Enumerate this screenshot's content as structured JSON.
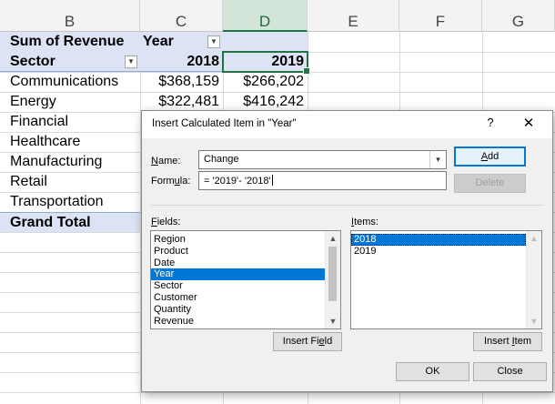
{
  "sheet": {
    "columns": [
      "B",
      "C",
      "D",
      "E",
      "F",
      "G"
    ],
    "pivot": {
      "corner_label": "Sum of Revenue",
      "col_field_label": "Year",
      "row_field_label": "Sector",
      "year_2018": "2018",
      "year_2019": "2019",
      "rows": [
        {
          "label": "Communications",
          "v2018": "$368,159",
          "v2019": "$266,202"
        },
        {
          "label": "Energy",
          "v2018": "$322,481",
          "v2019": "$416,242"
        },
        {
          "label": "Financial",
          "v2018": "",
          "v2019": ""
        },
        {
          "label": "Healthcare",
          "v2018": "",
          "v2019": ""
        },
        {
          "label": "Manufacturing",
          "v2018": "",
          "v2019": ""
        },
        {
          "label": "Retail",
          "v2018": "",
          "v2019": ""
        },
        {
          "label": "Transportation",
          "v2018": "",
          "v2019": ""
        }
      ],
      "grand_total_label": "Grand Total"
    }
  },
  "dialog": {
    "title": "Insert Calculated Item in \"Year\"",
    "help_glyph": "?",
    "close_glyph": "✕",
    "name_label_u": "N",
    "name_label_rest": "ame:",
    "name_value": "Change",
    "formula_label_pre": "Form",
    "formula_label_u": "u",
    "formula_label_post": "la:",
    "formula_value": "= '2019'- '2018'",
    "add_u": "A",
    "add_rest": "dd",
    "delete_label": "Delete",
    "fields_label_u": "F",
    "fields_label_rest": "ields:",
    "fields": [
      "Region",
      "Product",
      "Date",
      "Year",
      "Sector",
      "Customer",
      "Quantity",
      "Revenue"
    ],
    "fields_selected": "Year",
    "items_label_u": "I",
    "items_label_rest": "tems:",
    "items": [
      "2018",
      "2019"
    ],
    "items_selected": "2018",
    "insert_field_pre": "Insert Fi",
    "insert_field_u": "e",
    "insert_field_post": "ld",
    "insert_item_pre": "Insert ",
    "insert_item_u": "I",
    "insert_item_post": "tem",
    "ok_label": "OK",
    "close_label": "Close",
    "accent": "#0078d7"
  }
}
